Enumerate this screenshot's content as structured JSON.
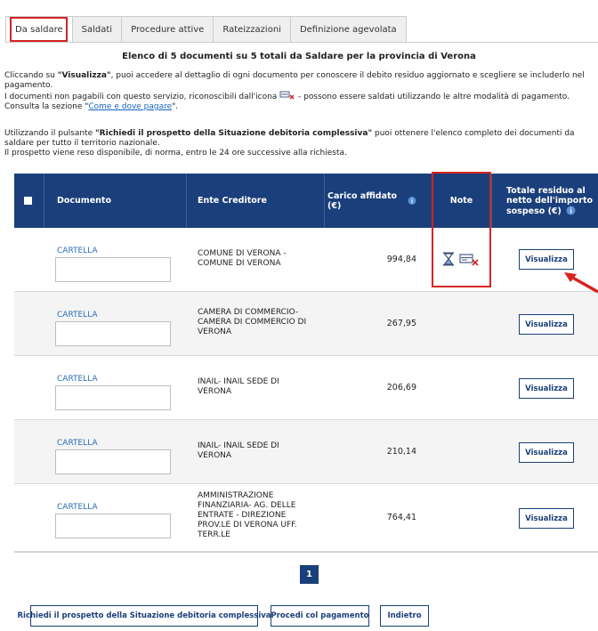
{
  "tabs": [
    {
      "label": "Da saldare",
      "active": true
    },
    {
      "label": "Saldati",
      "active": false
    },
    {
      "label": "Procedure attive",
      "active": false
    },
    {
      "label": "Rateizzazioni",
      "active": false
    },
    {
      "label": "Definizione agevolata",
      "active": false
    }
  ],
  "title": "Elenco di 5 documenti su 5 totali da Saldare per la provincia di Verona",
  "intro": {
    "p1_pre": "Cliccando su ",
    "p1_bold": "\"Visualizza\"",
    "p1_post": ", puoi accedere al dettaglio di ogni documento per conoscere il debito residuo aggiornato e scegliere se includerlo nel pagamento.",
    "p2_pre": "I documenti non pagabili con questo servizio, riconoscibili dall'icona",
    "p2_post": " - possono essere saldati utilizzando le altre modalità di pagamento. Consulta la sezione \"",
    "p2_link": "Come e dove pagare",
    "p2_end": "\".",
    "p3_pre": "Utilizzando il pulsante ",
    "p3_bold": "\"Richiedi il prospetto della Situazione debitoria complessiva\"",
    "p3_post": " puoi ottenere l'elenco completo dei documenti da saldare per tutto il territorio nazionale.",
    "p4": "Il prospetto viene reso disponibile, di norma, entro le 24 ore successive alla richiesta."
  },
  "table": {
    "headers": {
      "documento": "Documento",
      "ente": "Ente Creditore",
      "carico": "Carico affidato (€)",
      "note": "Note",
      "totale": "Totale residuo al netto dell'importo sospeso (€)"
    },
    "rows": [
      {
        "doc": "CARTELLA",
        "ente": "COMUNE DI VERONA - COMUNE DI VERONA",
        "amount": "994,84",
        "action": "Visualizza",
        "note_icons": true
      },
      {
        "doc": "CARTELLA",
        "ente": "CAMERA DI COMMERCIO- CAMERA DI COMMERCIO DI VERONA",
        "amount": "267,95",
        "action": "Visualizza",
        "note_icons": false
      },
      {
        "doc": "CARTELLA",
        "ente": "INAIL- INAIL SEDE DI VERONA",
        "amount": "206,69",
        "action": "Visualizza",
        "note_icons": false
      },
      {
        "doc": "CARTELLA",
        "ente": "INAIL- INAIL SEDE DI VERONA",
        "amount": "210,14",
        "action": "Visualizza",
        "note_icons": false
      },
      {
        "doc": "CARTELLA",
        "ente": "AMMINISTRAZIONE FINANZIARIA- AG. DELLE ENTRATE - DIREZIONE PROV.LE DI VERONA UFF. TERR.LE",
        "amount": "764,41",
        "action": "Visualizza",
        "note_icons": false
      }
    ]
  },
  "pagination": {
    "current": "1"
  },
  "footer": {
    "prospetto": "Richiedi il prospetto della Situazione debitoria complessiva",
    "procedi": "Procedi col pagamento",
    "indietro": "Indietro"
  },
  "colors": {
    "header": "#1a3f7a",
    "highlight": "#d62323",
    "link": "#1565c0"
  }
}
